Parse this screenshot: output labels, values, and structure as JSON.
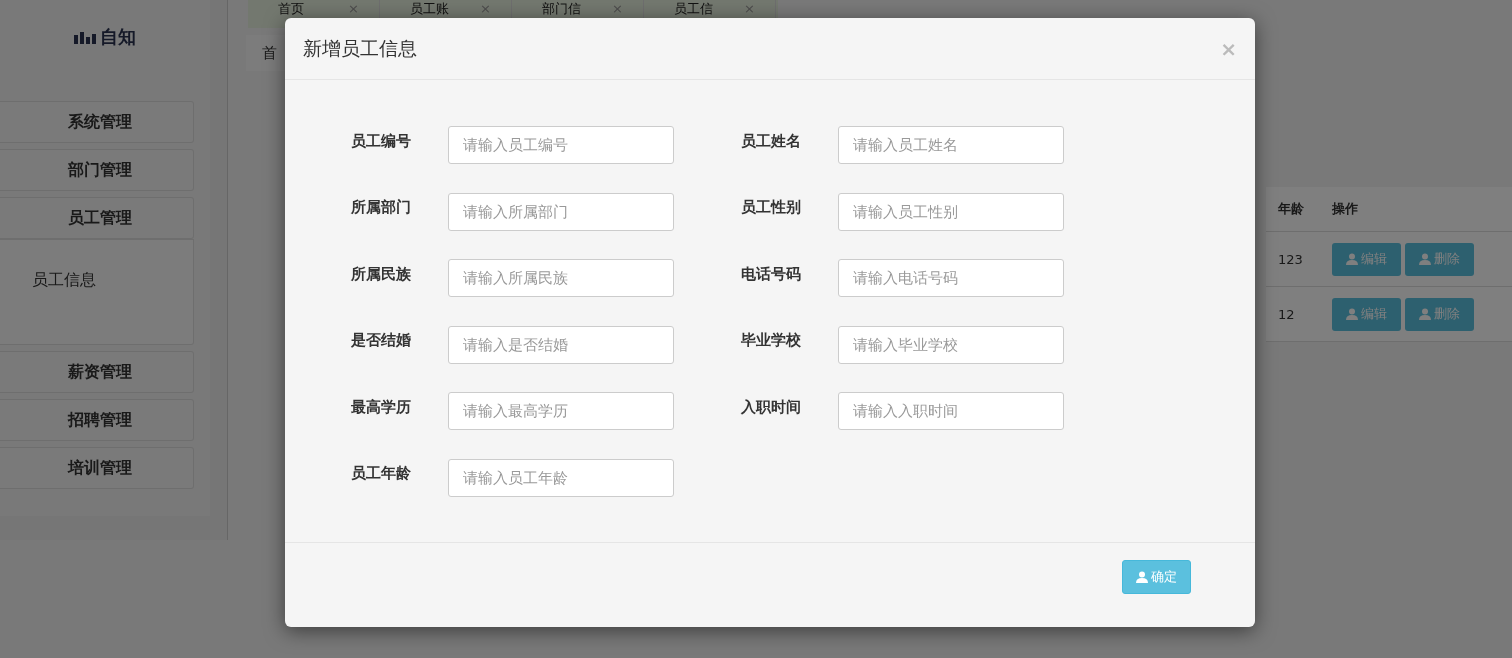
{
  "sidebar": {
    "logo": "自知",
    "menu": [
      {
        "label": "系统管理"
      },
      {
        "label": "部门管理"
      },
      {
        "label": "员工管理",
        "children": [
          {
            "label": "员工信息"
          }
        ]
      },
      {
        "label": "薪资管理"
      },
      {
        "label": "招聘管理"
      },
      {
        "label": "培训管理"
      }
    ]
  },
  "tabs": [
    {
      "label": "首页",
      "close": "×"
    },
    {
      "label": "员工账",
      "close": "×"
    },
    {
      "label": "部门信",
      "close": "×"
    },
    {
      "label": "员工信",
      "close": "×"
    }
  ],
  "breadcrumb": "首",
  "table": {
    "columns": [
      "年龄",
      "操作"
    ],
    "rows": [
      {
        "age": "123",
        "actions": [
          "编辑",
          "删除"
        ]
      },
      {
        "age": "12",
        "actions": [
          "编辑",
          "删除"
        ]
      }
    ]
  },
  "modal": {
    "title": "新增员工信息",
    "close": "×",
    "fields": [
      {
        "label": "员工编号",
        "placeholder": "请输入员工编号"
      },
      {
        "label": "员工姓名",
        "placeholder": "请输入员工姓名"
      },
      {
        "label": "所属部门",
        "placeholder": "请输入所属部门"
      },
      {
        "label": "员工性别",
        "placeholder": "请输入员工性别"
      },
      {
        "label": "所属民族",
        "placeholder": "请输入所属民族"
      },
      {
        "label": "电话号码",
        "placeholder": "请输入电话号码"
      },
      {
        "label": "是否结婚",
        "placeholder": "请输入是否结婚"
      },
      {
        "label": "毕业学校",
        "placeholder": "请输入毕业学校"
      },
      {
        "label": "最高学历",
        "placeholder": "请输入最高学历"
      },
      {
        "label": "入职时间",
        "placeholder": "请输入入职时间"
      },
      {
        "label": "员工年龄",
        "placeholder": "请输入员工年龄"
      }
    ],
    "submit": "确定"
  }
}
